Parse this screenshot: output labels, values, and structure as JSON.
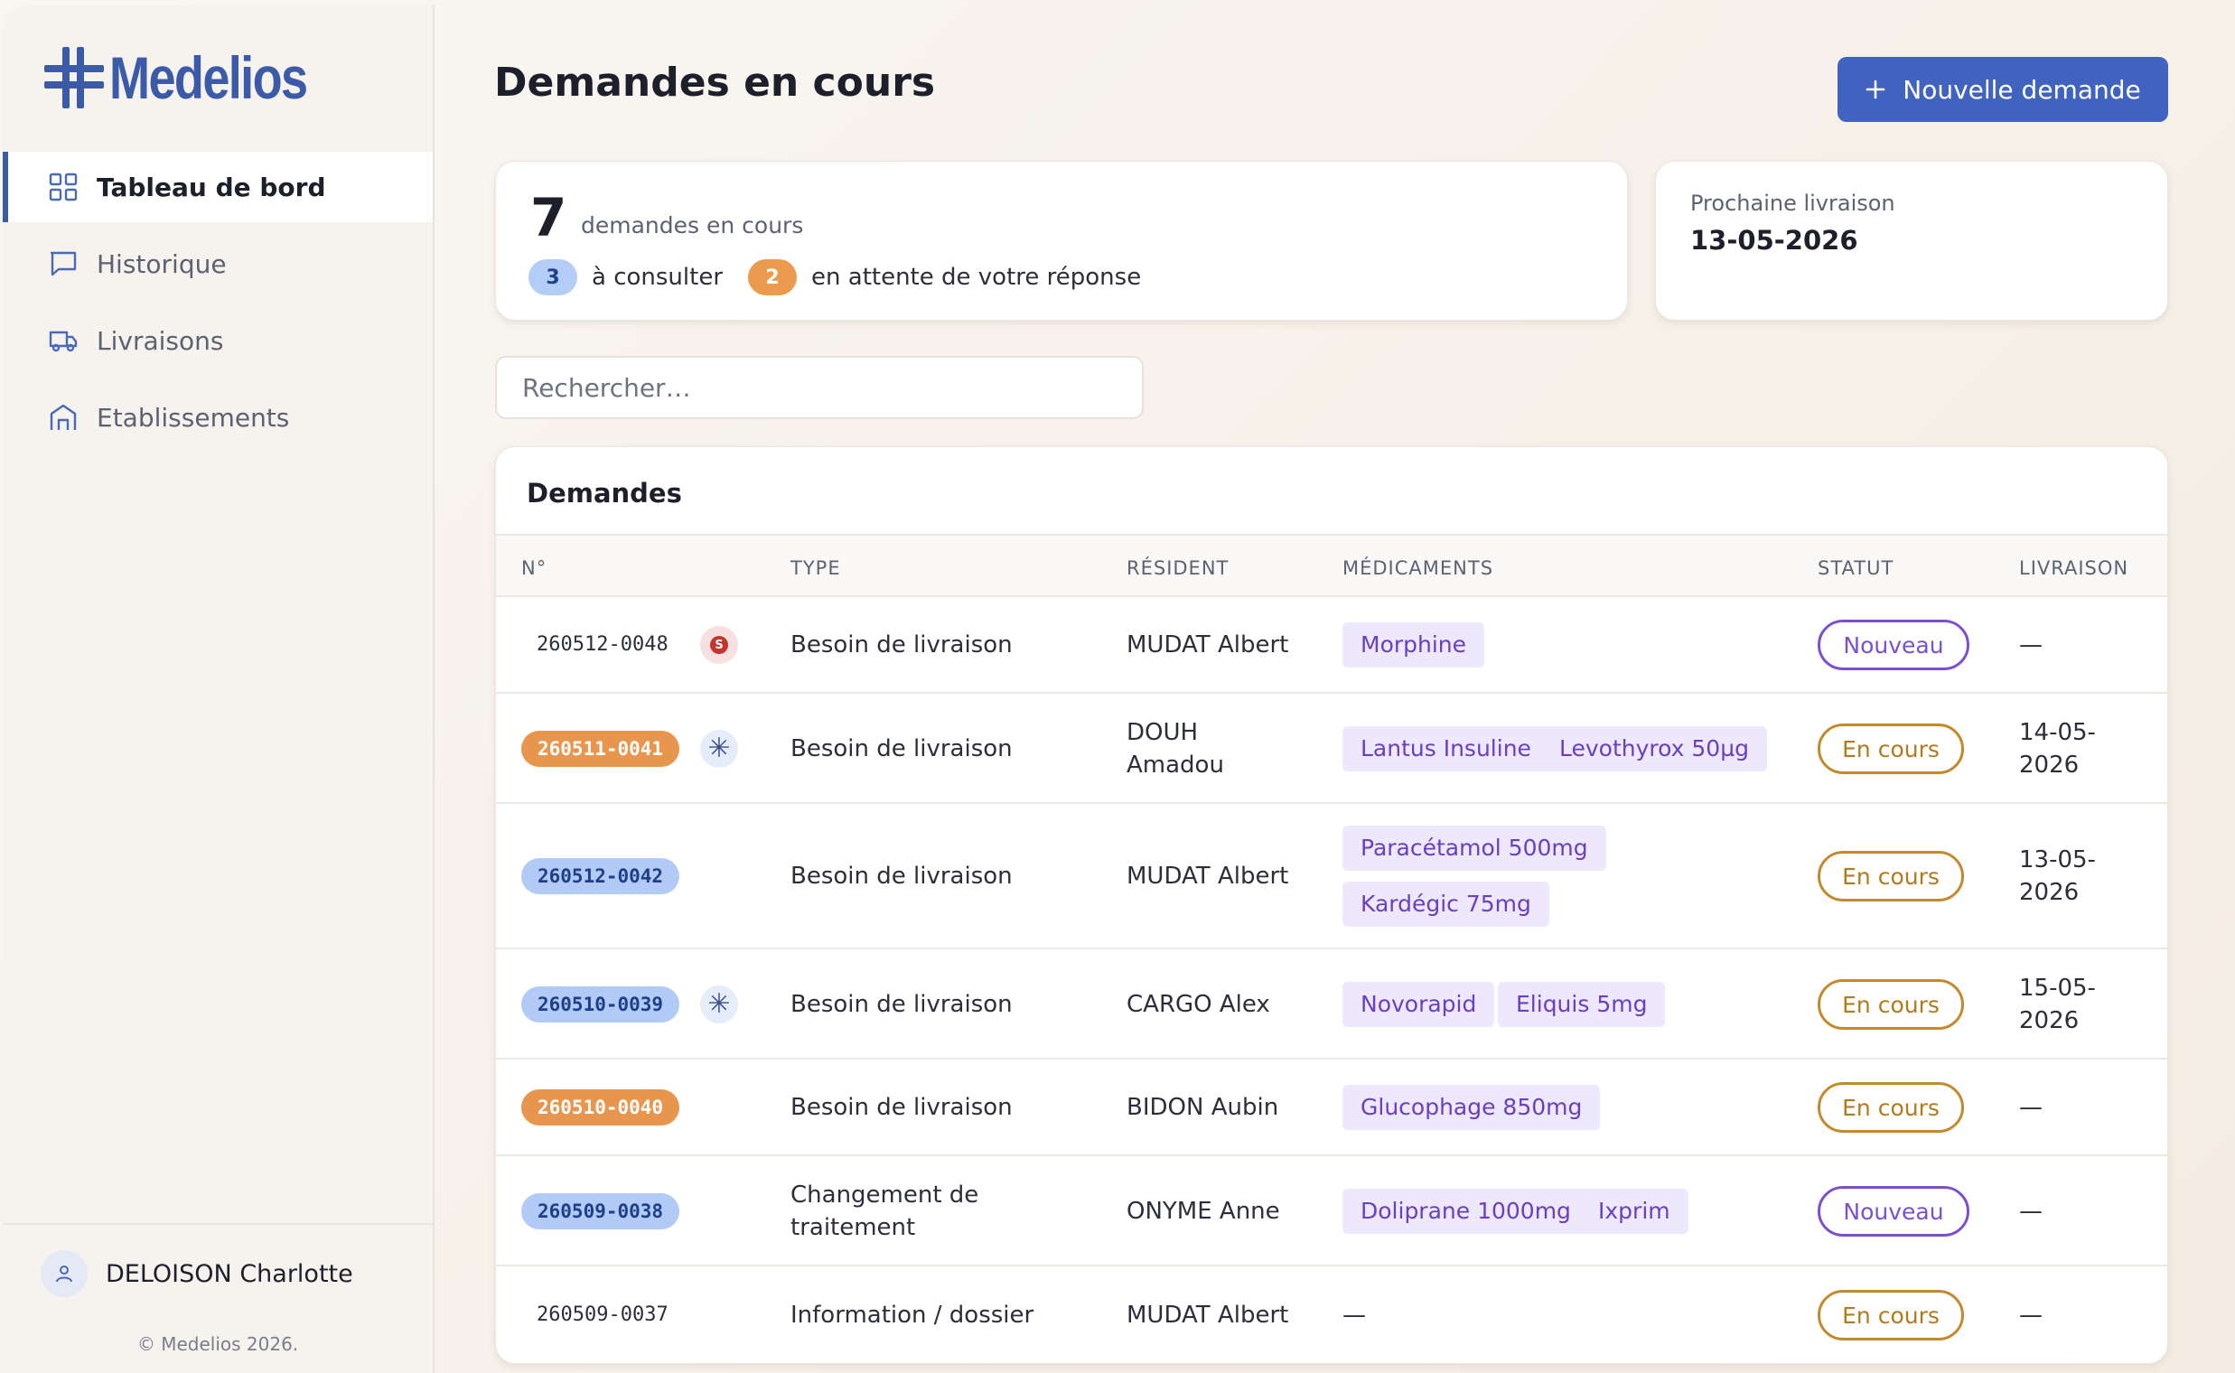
{
  "app": {
    "logo_text": "Medelios",
    "brand_color": "#3b5ba8"
  },
  "sidebar": {
    "items": [
      {
        "label": "Tableau de bord",
        "icon": "grid-icon",
        "active": true
      },
      {
        "label": "Historique",
        "icon": "chat-icon",
        "active": false
      },
      {
        "label": "Livraisons",
        "icon": "truck-icon",
        "active": false
      },
      {
        "label": "Etablissements",
        "icon": "building-icon",
        "active": false
      }
    ],
    "user": {
      "name": "DELOISON Charlotte"
    },
    "copyright": "© Medelios 2026."
  },
  "header": {
    "title": "Demandes en cours",
    "new_button_label": "Nouvelle demande"
  },
  "stats": {
    "count": "7",
    "count_label": "demandes en cours",
    "to_consult_count": "3",
    "to_consult_label": "à consulter",
    "awaiting_count": "2",
    "awaiting_label": "en attente de votre réponse"
  },
  "next_delivery": {
    "label": "Prochaine livraison",
    "date": "13-05-2026"
  },
  "search": {
    "placeholder": "Rechercher…"
  },
  "table": {
    "title": "Demandes",
    "columns": [
      "N°",
      "TYPE",
      "RÉSIDENT",
      "MÉDICAMENTS",
      "STATUT",
      "LIVRAISON"
    ],
    "rows": [
      {
        "num": "260512-0048",
        "num_style": "plain",
        "flag": "s",
        "type_l1": "Besoin de livraison",
        "type_l2": "",
        "resident_l1": "MUDAT Albert",
        "resident_l2": "",
        "meds": [
          "Morphine"
        ],
        "status": "Nouveau",
        "delivery_l1": "—",
        "delivery_l2": ""
      },
      {
        "num": "260511-0041",
        "num_style": "orange",
        "flag": "star",
        "type_l1": "Besoin de livraison",
        "type_l2": "",
        "resident_l1": "DOUH",
        "resident_l2": "Amadou",
        "meds": [
          "Lantus Insuline",
          "Levothyrox 50µg"
        ],
        "status": "En cours",
        "delivery_l1": "14-05-",
        "delivery_l2": "2026"
      },
      {
        "num": "260512-0042",
        "num_style": "blue",
        "flag": "",
        "type_l1": "Besoin de livraison",
        "type_l2": "",
        "resident_l1": "MUDAT Albert",
        "resident_l2": "",
        "meds": [
          "Paracétamol 500mg",
          "Kardégic 75mg"
        ],
        "status": "En cours",
        "delivery_l1": "13-05-",
        "delivery_l2": "2026"
      },
      {
        "num": "260510-0039",
        "num_style": "blue",
        "flag": "star",
        "type_l1": "Besoin de livraison",
        "type_l2": "",
        "resident_l1": "CARGO Alex",
        "resident_l2": "",
        "meds": [
          "Novorapid",
          "Eliquis 5mg"
        ],
        "status": "En cours",
        "delivery_l1": "15-05-",
        "delivery_l2": "2026"
      },
      {
        "num": "260510-0040",
        "num_style": "orange",
        "flag": "",
        "type_l1": "Besoin de livraison",
        "type_l2": "",
        "resident_l1": "BIDON Aubin",
        "resident_l2": "",
        "meds": [
          "Glucophage 850mg"
        ],
        "status": "En cours",
        "delivery_l1": "—",
        "delivery_l2": ""
      },
      {
        "num": "260509-0038",
        "num_style": "blue",
        "flag": "",
        "type_l1": "Changement de",
        "type_l2": "traitement",
        "resident_l1": "ONYME Anne",
        "resident_l2": "",
        "meds": [
          "Doliprane 1000mg",
          "Ixprim"
        ],
        "status": "Nouveau",
        "delivery_l1": "—",
        "delivery_l2": ""
      },
      {
        "num": "260509-0037",
        "num_style": "plain",
        "flag": "",
        "type_l1": "Information / dossier",
        "type_l2": "",
        "resident_l1": "MUDAT Albert",
        "resident_l2": "",
        "meds": [],
        "meds_empty": "—",
        "status": "En cours",
        "delivery_l1": "—",
        "delivery_l2": ""
      }
    ]
  },
  "colors": {
    "primary": "#3f63bf",
    "status_new": "#7b4fd0",
    "status_in_progress": "#c28a2a",
    "pill_orange": "#e8954d",
    "pill_blue": "#b1cbf6",
    "med_tag_bg": "#ede8fb",
    "urgent_red": "#c0352c"
  }
}
